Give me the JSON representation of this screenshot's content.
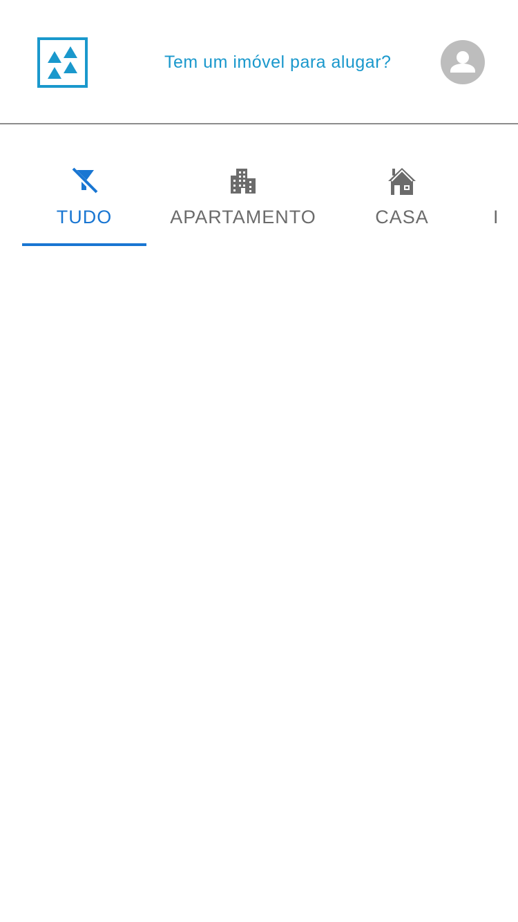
{
  "header": {
    "rent_link_label": "Tem um imóvel para alugar?",
    "brand_color": "#1a98cc",
    "avatar_icon": "account-circle-icon"
  },
  "tabs": [
    {
      "label": "TUDO",
      "icon": "filter-off-icon",
      "active": true
    },
    {
      "label": "APARTAMENTO",
      "icon": "apartment-building-icon",
      "active": false
    },
    {
      "label": "CASA",
      "icon": "house-icon",
      "active": false
    },
    {
      "label": "I",
      "icon": "",
      "active": false
    }
  ],
  "colors": {
    "active_tab": "#1976d2",
    "inactive_tab": "#6b6b6b",
    "divider": "#8c8c8c",
    "avatar_bg": "#bdbdbd"
  }
}
